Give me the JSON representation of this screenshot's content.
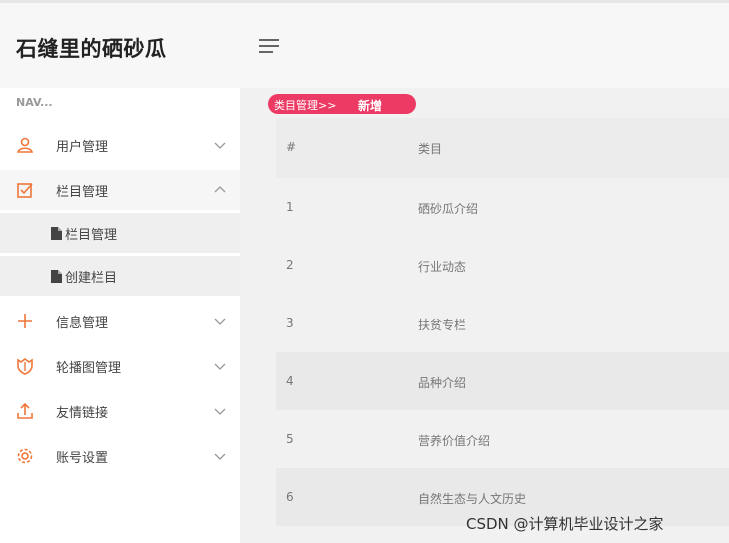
{
  "app": {
    "brand": "石缝里的硒砂瓜"
  },
  "sidebar": {
    "nav_title": "NAV...",
    "items": [
      {
        "label": "用户管理",
        "icon": "user-icon",
        "expanded": false
      },
      {
        "label": "栏目管理",
        "icon": "checkbox-icon",
        "expanded": true,
        "children": [
          {
            "label": "栏目管理",
            "icon": "file-icon"
          },
          {
            "label": "创建栏目",
            "icon": "file-icon"
          }
        ]
      },
      {
        "label": "信息管理",
        "icon": "plus-icon",
        "expanded": false
      },
      {
        "label": "轮播图管理",
        "icon": "shield-icon",
        "expanded": false
      },
      {
        "label": "友情链接",
        "icon": "upload-icon",
        "expanded": false
      },
      {
        "label": "账号设置",
        "icon": "gear-icon",
        "expanded": false
      }
    ]
  },
  "breadcrumb": {
    "path": "类目管理>>",
    "add_label": "新增"
  },
  "table": {
    "headers": [
      "#",
      "类目"
    ],
    "rows": [
      {
        "id": "1",
        "name": "硒砂瓜介绍"
      },
      {
        "id": "2",
        "name": "行业动态"
      },
      {
        "id": "3",
        "name": "扶贫专栏"
      },
      {
        "id": "4",
        "name": "品种介绍"
      },
      {
        "id": "5",
        "name": "营养价值介绍"
      },
      {
        "id": "6",
        "name": "自然生态与人文历史"
      }
    ]
  },
  "watermark": "CSDN @计算机毕业设计之家",
  "colors": {
    "accent": "#ec3a64",
    "icon_orange": "#f0773a"
  }
}
